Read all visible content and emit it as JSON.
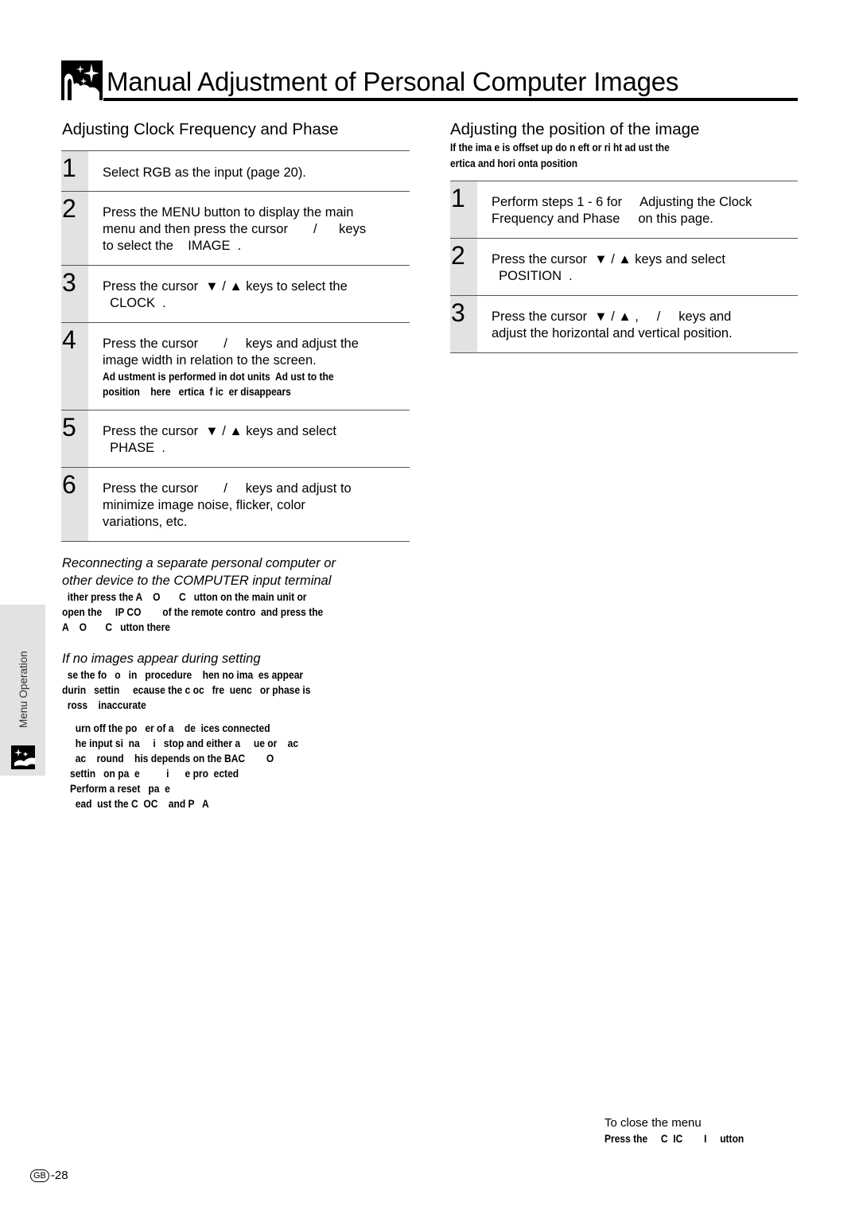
{
  "header": {
    "title": "Manual Adjustment of Personal Computer Images",
    "icon": "projector-stars-icon"
  },
  "left_section": {
    "heading": "Adjusting Clock Frequency and Phase",
    "steps": [
      {
        "num": "1",
        "text": "Select RGB as the input (page 20).",
        "note": ""
      },
      {
        "num": "2",
        "text_lines": [
          "Press the MENU button to display the main",
          "menu and then press the cursor       /      keys",
          "to select the    IMAGE  ."
        ],
        "note": ""
      },
      {
        "num": "3",
        "text_lines": [
          "Press the cursor  ▼ / ▲ keys to select the",
          "  CLOCK  ."
        ],
        "note": ""
      },
      {
        "num": "4",
        "text_lines": [
          "Press the cursor       /     keys and adjust the",
          "image width in relation to the screen."
        ],
        "note_lines": [
          "Ad ustment is performed in dot units  Ad ust to the",
          "position    here   ertica  f ic  er disappears"
        ]
      },
      {
        "num": "5",
        "text_lines": [
          "Press the cursor  ▼ / ▲ keys and select",
          "  PHASE  ."
        ],
        "note": ""
      },
      {
        "num": "6",
        "text_lines": [
          "Press the cursor       /     keys and adjust to",
          "minimize image noise, flicker, color",
          "variations, etc."
        ],
        "note": ""
      }
    ]
  },
  "notes": {
    "reconnect": {
      "title_lines": [
        "Reconnecting a separate personal computer or",
        "other device to the COMPUTER input terminal"
      ],
      "body_lines": [
        "  ither press the A    O       C   utton on the main unit or",
        "open the     IP CO        of the remote contro  and press the",
        "A    O       C   utton there"
      ]
    },
    "no_images": {
      "title": "If no images appear during setting",
      "body_lines": [
        "  se the fo   o   in   procedure    hen no ima  es appear",
        "durin   settin     ecause the c oc   fre  uenc   or phase is",
        "  ross    inaccurate"
      ],
      "list_lines": [
        "     urn off the po   er of a    de  ices connected",
        "     he input si  na     i   stop and either a     ue or    ac",
        "     ac    round    his depends on the BAC        O",
        "   settin   on pa  e          i      e pro  ected",
        "   Perform a reset   pa  e",
        "     ead  ust the C  OC    and P   A"
      ]
    }
  },
  "right_section": {
    "heading": "Adjusting the position of the image",
    "subtitle_lines": [
      "If the ima  e is offset up   do   n    eft or ri  ht   ad ust the",
      "  ertica   and hori  onta   position"
    ],
    "steps": [
      {
        "num": "1",
        "text_lines": [
          "Perform steps 1 - 6 for     Adjusting the Clock",
          "Frequency and Phase     on this page."
        ]
      },
      {
        "num": "2",
        "text_lines": [
          "Press the cursor  ▼ / ▲ keys and select",
          "  POSITION  ."
        ]
      },
      {
        "num": "3",
        "text_lines": [
          "Press the cursor  ▼ / ▲ ,     /     keys and",
          "adjust the horizontal and vertical position."
        ]
      }
    ]
  },
  "side_tab": {
    "label": "Menu Operation",
    "icon": "menu-operation-icon"
  },
  "footer": {
    "close_title": "To close the menu",
    "close_body": "Press the     C  IC        I     utton",
    "region_badge": "GB",
    "page_number": "-28"
  }
}
